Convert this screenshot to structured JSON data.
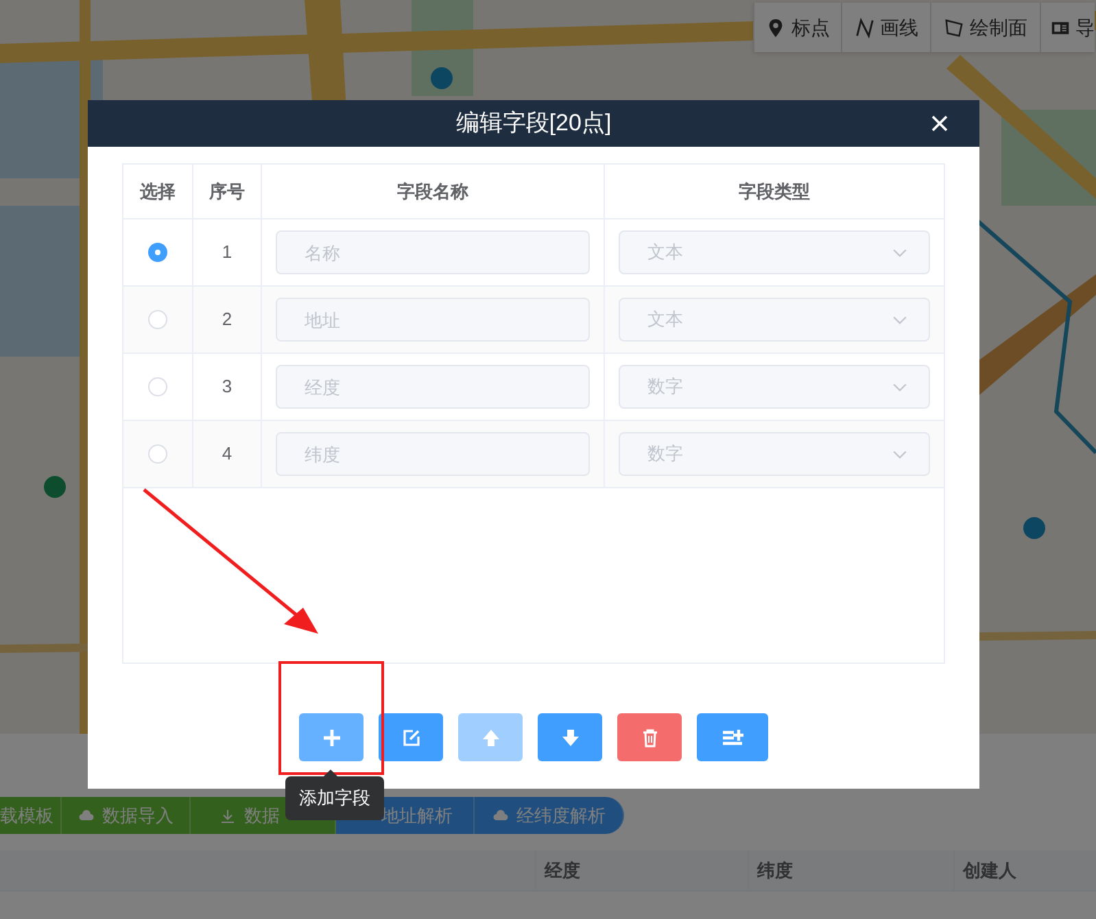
{
  "map_toolbar": [
    {
      "kind": "pin",
      "label": "标点"
    },
    {
      "kind": "line",
      "label": "画线"
    },
    {
      "kind": "polygon",
      "label": "绘制面"
    },
    {
      "kind": "card",
      "label": "导"
    }
  ],
  "action_bar": [
    {
      "label": "载模板"
    },
    {
      "label": "数据导入"
    },
    {
      "label": "数据"
    },
    {
      "label": "地址解析"
    },
    {
      "label": "经纬度解析"
    }
  ],
  "data_table": {
    "columns": [
      "经度",
      "纬度",
      "创建人"
    ]
  },
  "dialog": {
    "title": "编辑字段[20点]",
    "columns": [
      "选择",
      "序号",
      "字段名称",
      "字段类型"
    ],
    "rows": [
      {
        "selected": true,
        "index": "1",
        "name_placeholder": "名称",
        "type": "文本"
      },
      {
        "selected": false,
        "index": "2",
        "name_placeholder": "地址",
        "type": "文本"
      },
      {
        "selected": false,
        "index": "3",
        "name_placeholder": "经度",
        "type": "数字"
      },
      {
        "selected": false,
        "index": "4",
        "name_placeholder": "纬度",
        "type": "数字"
      }
    ],
    "buttons": [
      {
        "kind": "add",
        "hovered": true,
        "disabled": false
      },
      {
        "kind": "edit",
        "hovered": false,
        "disabled": false
      },
      {
        "kind": "up",
        "hovered": false,
        "disabled": true
      },
      {
        "kind": "down",
        "hovered": false,
        "disabled": false
      },
      {
        "kind": "delete",
        "hovered": false,
        "disabled": false
      },
      {
        "kind": "insert",
        "hovered": false,
        "disabled": false
      }
    ],
    "tooltip": "添加字段"
  }
}
